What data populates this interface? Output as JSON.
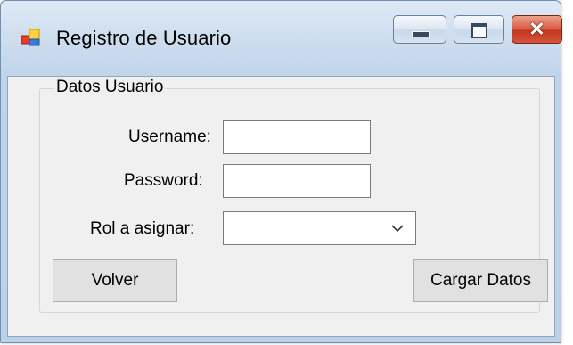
{
  "window": {
    "title": "Registro de Usuario",
    "icon": "windows-form-icon"
  },
  "caption_buttons": {
    "minimize": "minimize-icon",
    "maximize": "maximize-icon",
    "close_glyph": "✕"
  },
  "group": {
    "legend": "Datos Usuario"
  },
  "form": {
    "username_label": "Username:",
    "username_value": "",
    "password_label": "Password:",
    "password_value": "",
    "role_label": "Rol a asignar:",
    "role_value": ""
  },
  "buttons": {
    "back": "Volver",
    "load": "Cargar Datos"
  },
  "colors": {
    "titlebar": "#cfdeef",
    "client_background": "#f0f0f0",
    "button_face": "#e1e1e1",
    "close_button": "#c3371f"
  }
}
